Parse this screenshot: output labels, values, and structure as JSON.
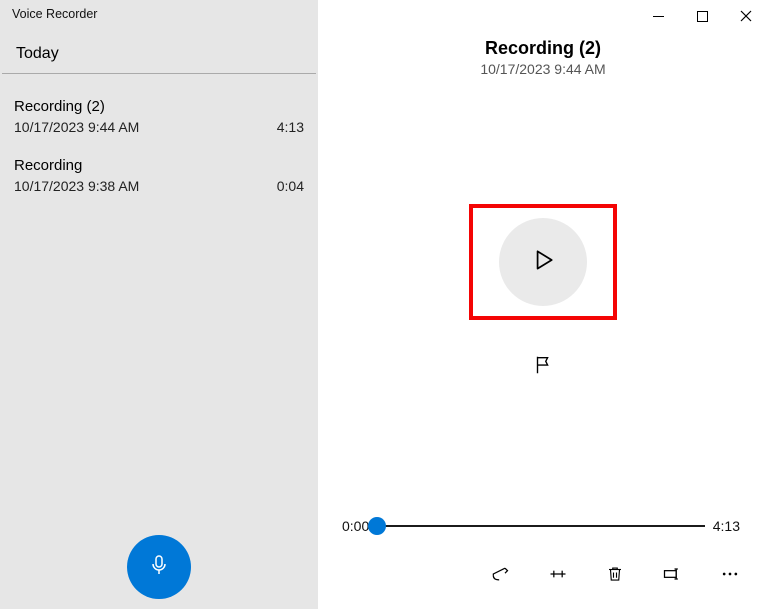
{
  "app": {
    "title": "Voice Recorder"
  },
  "sidebar": {
    "sectionHeader": "Today",
    "items": [
      {
        "title": "Recording (2)",
        "timestamp": "10/17/2023 9:44 AM",
        "duration": "4:13"
      },
      {
        "title": "Recording",
        "timestamp": "10/17/2023 9:38 AM",
        "duration": "0:04"
      }
    ]
  },
  "main": {
    "title": "Recording (2)",
    "subtitle": "10/17/2023 9:44 AM",
    "timeline": {
      "current": "0:00",
      "total": "4:13"
    }
  },
  "colors": {
    "accent": "#0078d7",
    "highlight": "#f40404"
  }
}
